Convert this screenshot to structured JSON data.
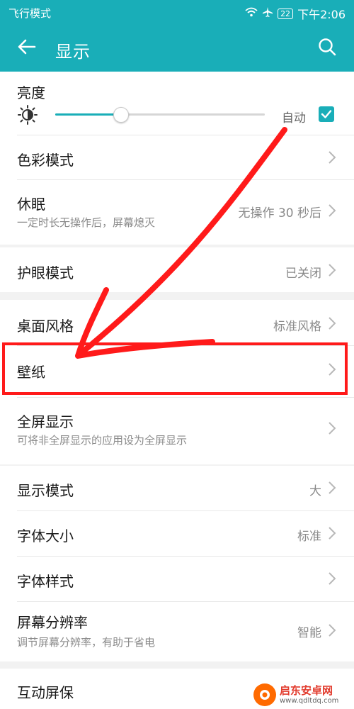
{
  "status_bar": {
    "left": "飞行模式",
    "battery": "22",
    "time": "下午2:06"
  },
  "app_bar": {
    "title": "显示"
  },
  "brightness": {
    "label": "亮度",
    "level_fraction": 0.31,
    "auto_label": "自动",
    "auto_checked": true
  },
  "items": {
    "color_mode": {
      "label": "色彩模式"
    },
    "sleep": {
      "label": "休眠",
      "sub": "一定时长无操作后，屏幕熄灭",
      "value": "无操作 30 秒后"
    },
    "eye_comfort": {
      "label": "护眼模式",
      "value": "已关闭"
    },
    "desktop_style": {
      "label": "桌面风格",
      "value": "标准风格"
    },
    "wallpaper": {
      "label": "壁纸"
    },
    "full_screen": {
      "label": "全屏显示",
      "sub": "可将非全屏显示的应用设为全屏显示"
    },
    "display_mode": {
      "label": "显示模式",
      "value": "大"
    },
    "font_size": {
      "label": "字体大小",
      "value": "标准"
    },
    "font_style": {
      "label": "字体样式"
    },
    "resolution": {
      "label": "屏幕分辨率",
      "sub": "调节屏幕分辨率，有助于省电",
      "value": "智能"
    },
    "interactive_screensaver": {
      "label": "互动屏保"
    }
  },
  "watermark": {
    "name": "启东安卓网",
    "url": "www.qdltdq.com"
  },
  "colors": {
    "accent": "#19aeb8",
    "annotation": "#ff1a1a"
  }
}
